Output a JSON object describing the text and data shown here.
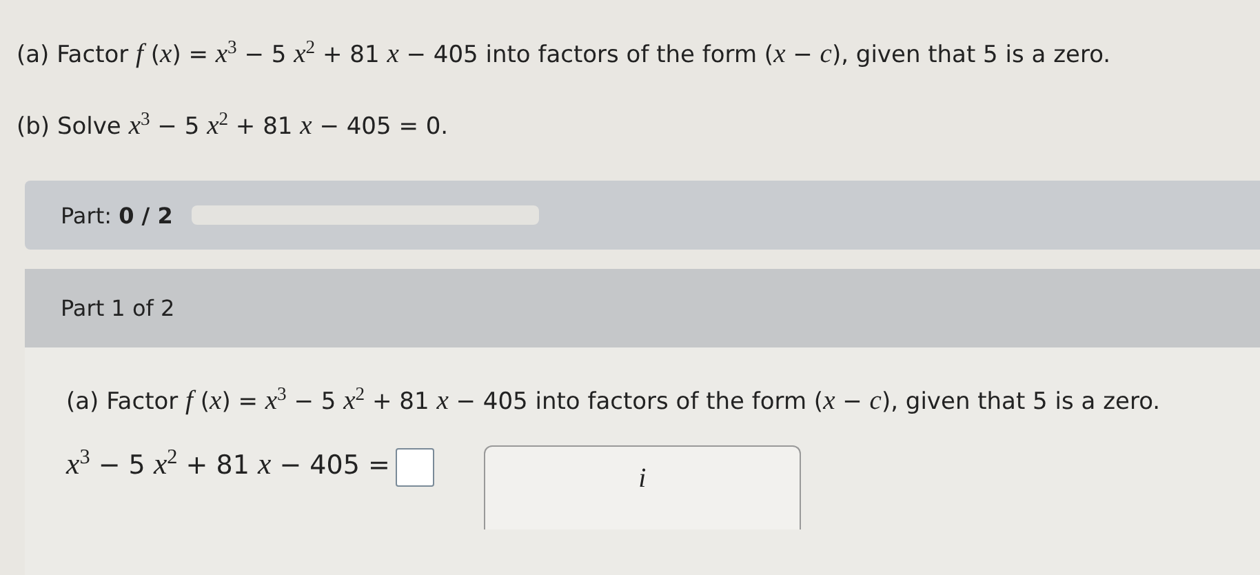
{
  "question": {
    "part_a": "(a) Factor *f* (*x*) = *x*$^{3}$ − 5 *x*$^{2}$ + 81 *x* − 405 into factors of the form (*x* − *c*), given that 5 is a zero.",
    "part_b": "(b) Solve *x*$^{3}$ − 5 *x*$^{2}$ + 81 *x* − 405 = 0."
  },
  "progress": {
    "label": "Part:",
    "value": "0 / 2"
  },
  "part": {
    "title": "Part 1 of 2",
    "prompt": "(a) Factor *f* (*x*) = *x*$^{3}$ − 5 *x*$^{2}$ + 81 *x* − 405 into factors of the form (*x* − *c*), given that 5 is a zero.",
    "equation": "*x*$^{3}$ − 5 *x*$^{2}$ + 81 *x* − 405 =",
    "tool": "i"
  }
}
